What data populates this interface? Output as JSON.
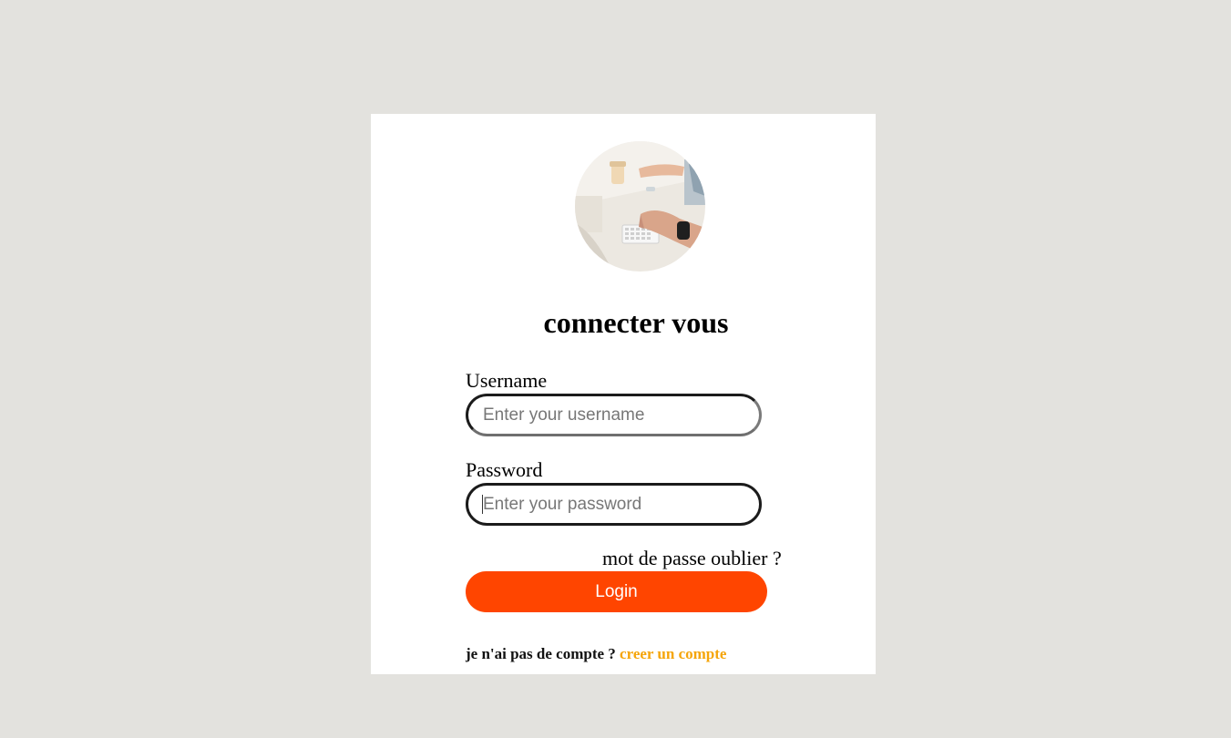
{
  "card": {
    "avatar_alt": "workspace photo",
    "title": "connecter vous"
  },
  "username": {
    "label": "Username",
    "placeholder": "Enter your username",
    "value": ""
  },
  "password": {
    "label": "Password",
    "placeholder": "Enter your password",
    "value": ""
  },
  "forgot_link": "mot de passe oublier ?",
  "login_button": "Login",
  "signup": {
    "prompt": "je n'ai pas de compte ?",
    "link": "creer un compte"
  },
  "colors": {
    "background": "#e3e2de",
    "card": "#ffffff",
    "accent": "#ff4500",
    "link": "#f5a50a"
  }
}
